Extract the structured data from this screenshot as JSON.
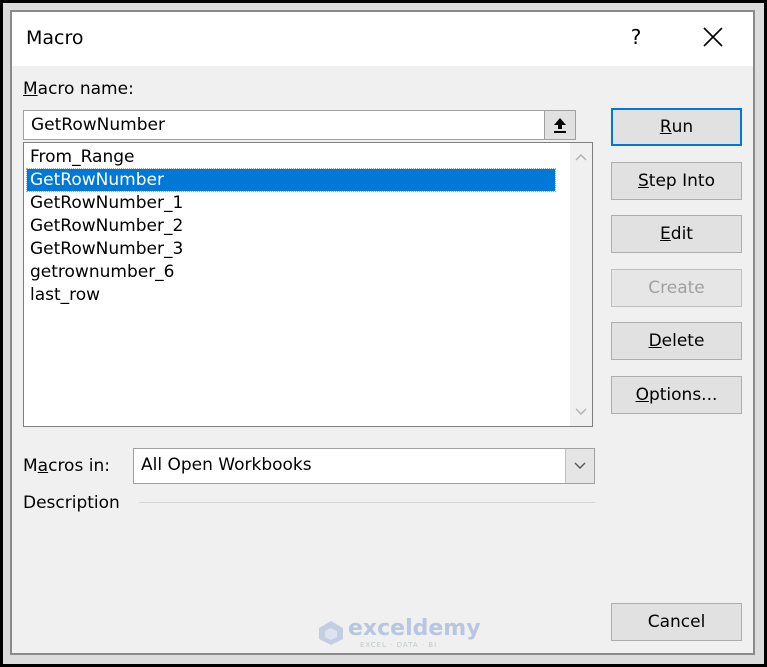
{
  "dialog": {
    "title": "Macro",
    "help_label": "?",
    "close_icon": "close-icon"
  },
  "macro_name": {
    "label_prefix": "M",
    "label_rest": "acro name:",
    "value": "GetRowNumber",
    "upload_icon": "arrow-up-icon"
  },
  "macro_list": {
    "items": [
      "From_Range",
      "GetRowNumber",
      "GetRowNumber_1",
      "GetRowNumber_2",
      "GetRowNumber_3",
      "getrownumber_6",
      "last_row"
    ],
    "selected_index": 1
  },
  "buttons": {
    "run": {
      "accel": "R",
      "rest": "un"
    },
    "step_into": {
      "accel": "S",
      "rest": "tep Into"
    },
    "edit": {
      "accel": "E",
      "rest": "dit"
    },
    "create": {
      "label": "Create",
      "disabled": true
    },
    "delete": {
      "accel": "D",
      "rest": "elete"
    },
    "options": {
      "accel": "O",
      "rest": "ptions..."
    },
    "cancel": "Cancel"
  },
  "macros_in": {
    "label_pre": "M",
    "label_accel": "a",
    "label_rest": "cros in:",
    "value": "All Open Workbooks"
  },
  "description": {
    "label": "Description"
  },
  "watermark": {
    "name": "exceldemy",
    "tagline": "EXCEL · DATA · BI"
  },
  "colors": {
    "selection": "#0078d7",
    "default_button_border": "#0078d7"
  }
}
